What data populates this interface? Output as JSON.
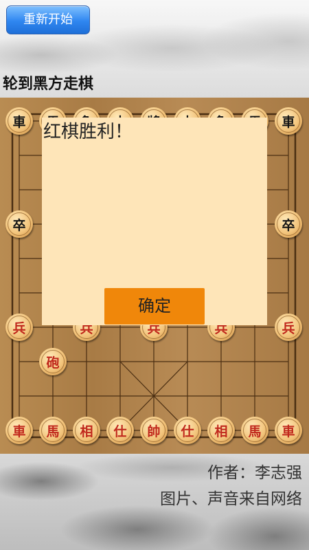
{
  "toolbar": {
    "restart_label": "重新开始"
  },
  "status": {
    "turn_text": "轮到黑方走棋"
  },
  "board": {
    "pieces": [
      {
        "char": "車",
        "side": "black",
        "col": 0,
        "row": 0
      },
      {
        "char": "馬",
        "side": "black",
        "col": 1,
        "row": 0
      },
      {
        "char": "象",
        "side": "black",
        "col": 2,
        "row": 0
      },
      {
        "char": "士",
        "side": "black",
        "col": 3,
        "row": 0
      },
      {
        "char": "將",
        "side": "black",
        "col": 4,
        "row": 0
      },
      {
        "char": "士",
        "side": "black",
        "col": 5,
        "row": 0
      },
      {
        "char": "象",
        "side": "black",
        "col": 6,
        "row": 0
      },
      {
        "char": "馬",
        "side": "black",
        "col": 7,
        "row": 0
      },
      {
        "char": "車",
        "side": "black",
        "col": 8,
        "row": 0
      },
      {
        "char": "卒",
        "side": "black",
        "col": 0,
        "row": 3
      },
      {
        "char": "卒",
        "side": "black",
        "col": 8,
        "row": 3
      },
      {
        "char": "兵",
        "side": "red",
        "col": 0,
        "row": 6
      },
      {
        "char": "兵",
        "side": "red",
        "col": 2,
        "row": 6
      },
      {
        "char": "兵",
        "side": "red",
        "col": 4,
        "row": 6
      },
      {
        "char": "兵",
        "side": "red",
        "col": 6,
        "row": 6
      },
      {
        "char": "兵",
        "side": "red",
        "col": 8,
        "row": 6
      },
      {
        "char": "砲",
        "side": "red",
        "col": 1,
        "row": 7
      },
      {
        "char": "車",
        "side": "red",
        "col": 0,
        "row": 9
      },
      {
        "char": "馬",
        "side": "red",
        "col": 1,
        "row": 9
      },
      {
        "char": "相",
        "side": "red",
        "col": 2,
        "row": 9
      },
      {
        "char": "仕",
        "side": "red",
        "col": 3,
        "row": 9
      },
      {
        "char": "帥",
        "side": "red",
        "col": 4,
        "row": 9
      },
      {
        "char": "仕",
        "side": "red",
        "col": 5,
        "row": 9
      },
      {
        "char": "相",
        "side": "red",
        "col": 6,
        "row": 9
      },
      {
        "char": "馬",
        "side": "red",
        "col": 7,
        "row": 9
      },
      {
        "char": "車",
        "side": "red",
        "col": 8,
        "row": 9
      }
    ]
  },
  "dialog": {
    "message": "红棋胜利！",
    "ok_label": "确定"
  },
  "credits": {
    "author": "作者：李志强",
    "source": "图片、声音来自网络"
  },
  "colors": {
    "red_piece": "#c0281c",
    "black_piece": "#141414",
    "ok_button": "#f0870a",
    "dialog_bg": "#fee5b8"
  }
}
